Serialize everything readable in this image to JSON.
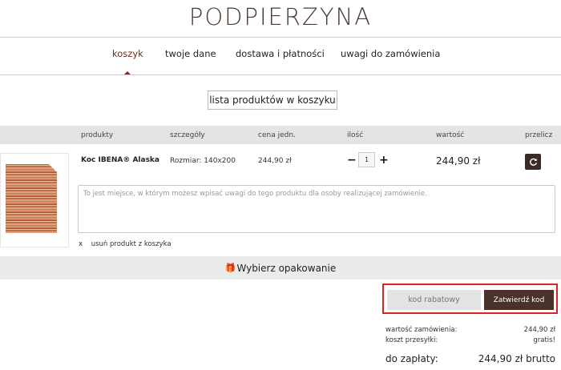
{
  "brand": {
    "logo_text": "PODPIERZYNA"
  },
  "steps": [
    {
      "label": "koszyk",
      "active": true
    },
    {
      "label": "twoje dane",
      "active": false
    },
    {
      "label": "dostawa i płatności",
      "active": false
    },
    {
      "label": "uwagi do zamówienia",
      "active": false
    }
  ],
  "section_title": "lista produktów w koszyku",
  "table": {
    "headers": [
      "produkty",
      "szczegóły",
      "cena jedn.",
      "ilość",
      "wartość",
      "przelicz"
    ],
    "row": {
      "product_name": "Koc IBENA® Alaska",
      "details": "Rozmiar: 140x200",
      "unit_price": "244,90 zł",
      "quantity": "1",
      "value": "244,90 zł",
      "note_placeholder": "To jest miejsce, w którym możesz wpisać uwagi do tego produktu dla osoby realizującej zamówienie.",
      "remove_x": "x",
      "remove_label": "usuń produkt z koszyka"
    }
  },
  "packaging": {
    "label": "Wybierz opakowanie",
    "icon": "gift-icon"
  },
  "discount": {
    "placeholder": "kod rabatowy",
    "button_label": "Zatwierdź kod"
  },
  "summary": {
    "order_value_label": "wartość zamówienia:",
    "order_value": "244,90 zł",
    "shipping_label": "koszt przesyłki:",
    "shipping_value": "gratis!",
    "total_label": "do zapłaty:",
    "total_value": "244,90 zł brutto"
  },
  "colors": {
    "accent": "#7a2a1a",
    "button_dark": "#4a3129",
    "highlight_border": "#dd2222"
  }
}
